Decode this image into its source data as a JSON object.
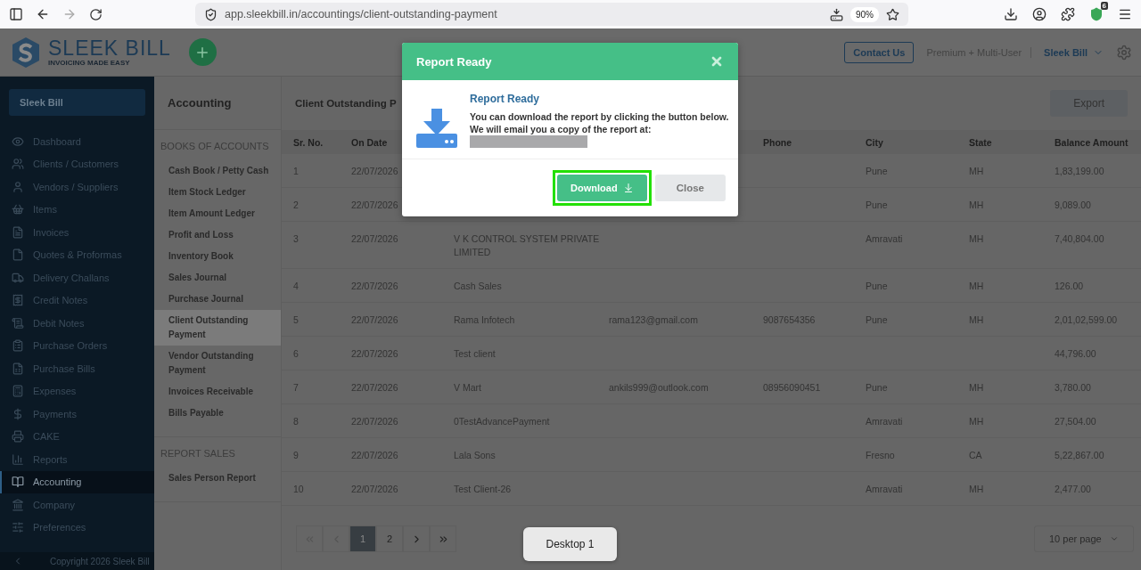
{
  "browser": {
    "url": "app.sleekbill.in/accountings/client-outstanding-payment",
    "zoom": "90%",
    "extension_badge": "6",
    "forward_disabled": true
  },
  "header": {
    "logo_name": "SLEEK BILL",
    "logo_tagline": "INVOICING MADE EASY",
    "contact_button": "Contact Us",
    "plan": "Premium + Multi-User",
    "account": "Sleek Bill"
  },
  "sidebar": {
    "company_button": "Sleek Bill",
    "items": [
      {
        "label": "Dashboard",
        "selected": false
      },
      {
        "label": "Clients / Customers",
        "selected": false
      },
      {
        "label": "Vendors / Suppliers",
        "selected": false
      },
      {
        "label": "Items",
        "selected": false
      },
      {
        "label": "Invoices",
        "selected": false
      },
      {
        "label": "Quotes & Proformas",
        "selected": false
      },
      {
        "label": "Delivery Challans",
        "selected": false
      },
      {
        "label": "Credit Notes",
        "selected": false
      },
      {
        "label": "Debit Notes",
        "selected": false
      },
      {
        "label": "Purchase Orders",
        "selected": false
      },
      {
        "label": "Purchase Bills",
        "selected": false
      },
      {
        "label": "Expenses",
        "selected": false
      },
      {
        "label": "Payments",
        "selected": false
      },
      {
        "label": "CAKE",
        "selected": false
      },
      {
        "label": "Reports",
        "selected": false
      },
      {
        "label": "Accounting",
        "selected": true
      },
      {
        "label": "Company",
        "selected": false
      },
      {
        "label": "Preferences",
        "selected": false
      }
    ],
    "copyright": "Copyright 2026 Sleek Bill"
  },
  "submenu": {
    "title": "Accounting",
    "sections": [
      {
        "heading": "BOOKS OF ACCOUNTS",
        "items": [
          {
            "label": "Cash Book / Petty Cash",
            "selected": false
          },
          {
            "label": "Item Stock Ledger",
            "selected": false
          },
          {
            "label": "Item Amount Ledger",
            "selected": false
          },
          {
            "label": "Profit and Loss",
            "selected": false
          },
          {
            "label": "Inventory Book",
            "selected": false
          },
          {
            "label": "Sales Journal",
            "selected": false
          },
          {
            "label": "Purchase Journal",
            "selected": false
          },
          {
            "label": "Client Outstanding Payment",
            "selected": true
          },
          {
            "label": "Vendor Outstanding Payment",
            "selected": false
          },
          {
            "label": "Invoices Receivable",
            "selected": false
          },
          {
            "label": "Bills Payable",
            "selected": false
          }
        ]
      },
      {
        "heading": "REPORT SALES",
        "items": [
          {
            "label": "Sales Person Report",
            "selected": false
          }
        ]
      }
    ]
  },
  "main": {
    "title": "Client Outstanding P",
    "export_button": "Export",
    "table": {
      "columns": [
        "Sr. No.",
        "On Date",
        "",
        "",
        "Phone",
        "City",
        "State",
        "Balance Amount"
      ],
      "rows": [
        {
          "sr": "1",
          "date": "22/07/2026",
          "city": "Pune",
          "state": "MH",
          "balance": "1,83,199.00"
        },
        {
          "sr": "2",
          "date": "22/07/2026",
          "city": "Pune",
          "state": "MH",
          "balance": "9,089.00"
        },
        {
          "sr": "3",
          "date": "22/07/2026",
          "name": "V K CONTROL SYSTEM PRIVATE LIMITED",
          "city": "Amravati",
          "state": "MH",
          "balance": "7,40,804.00"
        },
        {
          "sr": "4",
          "date": "22/07/2026",
          "name": "Cash Sales",
          "city": "Pune",
          "state": "MH",
          "balance": "126.00"
        },
        {
          "sr": "5",
          "date": "22/07/2026",
          "name": "Rama Infotech",
          "email": "rama123@gmail.com",
          "phone": "9087654356",
          "city": "Pune",
          "state": "MH",
          "balance": "2,01,02,599.00"
        },
        {
          "sr": "6",
          "date": "22/07/2026",
          "name": "Test client",
          "balance": "44,796.00"
        },
        {
          "sr": "7",
          "date": "22/07/2026",
          "name": "V Mart",
          "email": "ankils999@outlook.com",
          "phone": "08956090451",
          "city": "Pune",
          "state": "MH",
          "balance": "3,780.00"
        },
        {
          "sr": "8",
          "date": "22/07/2026",
          "name": "0TestAdvancePayment",
          "city": "Amravati",
          "state": "MH",
          "balance": "27,504.00"
        },
        {
          "sr": "9",
          "date": "22/07/2026",
          "name": "Lala Sons",
          "city": "Fresno",
          "state": "CA",
          "balance": "5,22,867.00"
        },
        {
          "sr": "10",
          "date": "22/07/2026",
          "name": "Test Client-26",
          "city": "Amravati",
          "state": "MH",
          "balance": "2,477.00"
        }
      ]
    },
    "pagination": {
      "first_disabled": true,
      "prev_disabled": true,
      "pages": [
        {
          "label": "1",
          "selected": true
        },
        {
          "label": "2",
          "selected": false
        }
      ],
      "per_page": "10 per page"
    }
  },
  "modal": {
    "title": "Report Ready",
    "heading": "Report Ready",
    "message": "You can download the report by clicking the button below. We will email you a copy of the report at:",
    "download_button": "Download",
    "close_button": "Close"
  },
  "desktop_tooltip": "Desktop 1"
}
